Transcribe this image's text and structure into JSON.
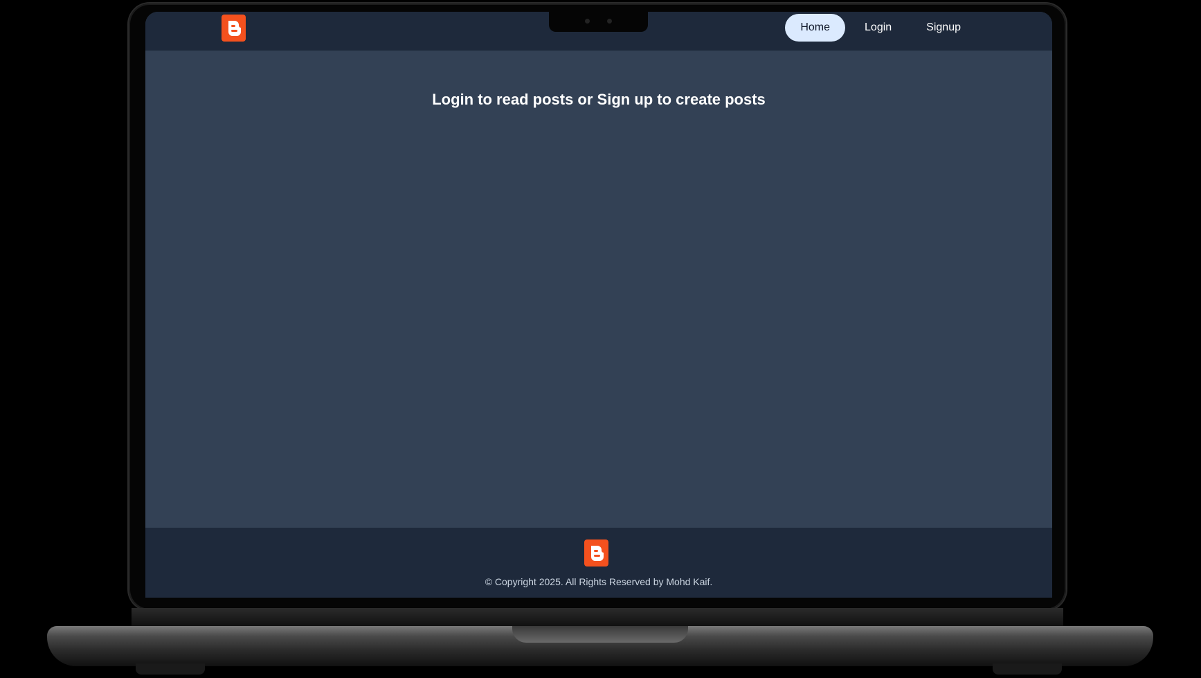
{
  "navbar": {
    "logo_icon": "blogger-logo-icon",
    "links": [
      {
        "label": "Home",
        "active": true
      },
      {
        "label": "Login",
        "active": false
      },
      {
        "label": "Signup",
        "active": false
      }
    ]
  },
  "main": {
    "message": "Login to read posts or Sign up to create posts"
  },
  "footer": {
    "logo_icon": "blogger-logo-icon",
    "copyright": "© Copyright 2025. All Rights Reserved by Mohd Kaif."
  },
  "colors": {
    "navbar_bg": "#1e293b",
    "page_bg": "#334155",
    "brand": "#f4511e",
    "active_link_bg": "#dbeafe"
  }
}
